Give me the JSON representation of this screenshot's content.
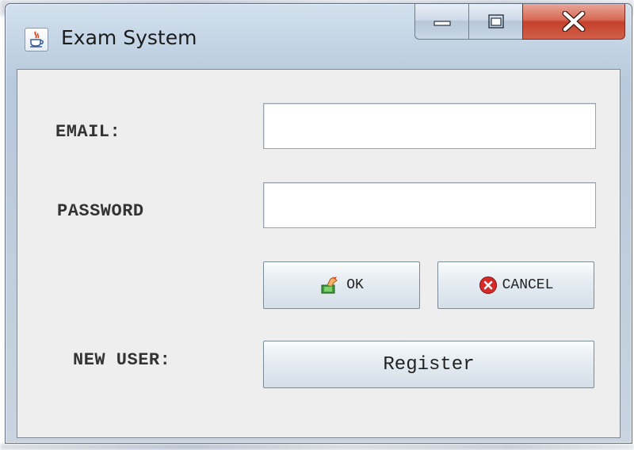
{
  "window": {
    "title": "Exam System"
  },
  "form": {
    "email_label": "EMAIL:",
    "email_value": "",
    "password_label": "PASSWORD",
    "password_value": "",
    "ok_label": "OK",
    "cancel_label": "CANCEL",
    "new_user_label": "NEW USER:",
    "register_label": "Register"
  },
  "icons": {
    "app": "java-cup-icon",
    "ok": "hand-money-icon",
    "cancel": "red-x-circle-icon",
    "minimize": "minimize-icon",
    "maximize": "maximize-icon",
    "close": "close-icon"
  },
  "colors": {
    "close_button": "#c4412b",
    "cancel_icon": "#d62a2a",
    "ok_icon": "#3e9a3a",
    "client_bg": "#eeeeee"
  }
}
